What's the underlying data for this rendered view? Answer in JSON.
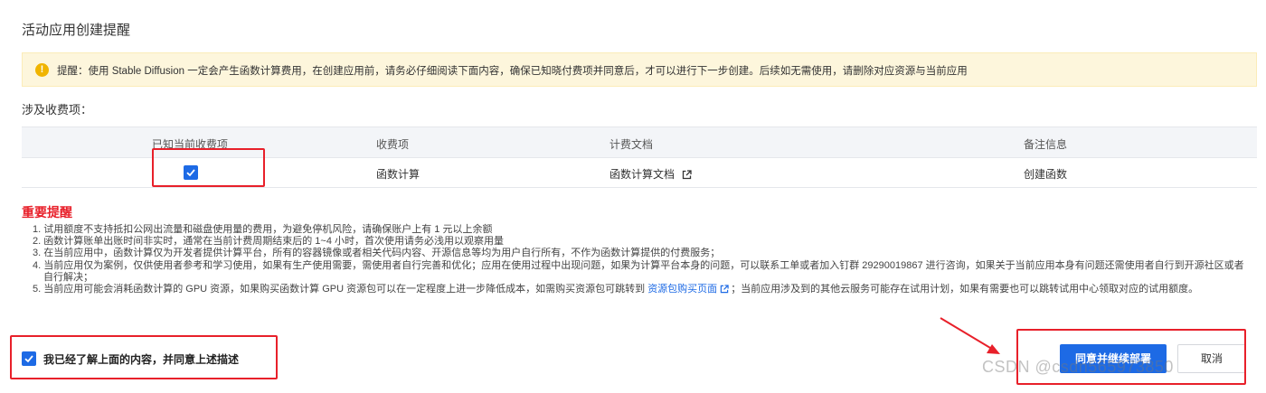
{
  "page": {
    "title": "活动应用创建提醒"
  },
  "notice": {
    "icon": "warning-icon",
    "text": "提醒：使用 Stable Diffusion 一定会产生函数计算费用，在创建应用前，请务必仔细阅读下面内容，确保已知晓付费项并同意后，才可以进行下一步创建。后续如无需使用，请删除对应资源与当前应用"
  },
  "billing": {
    "section_label": "涉及收费项：",
    "headers": [
      "已知当前收费项",
      "收费项",
      "计费文档",
      "备注信息"
    ],
    "rows": [
      {
        "acknowledged": true,
        "item": "函数计算",
        "doc_link": "函数计算文档",
        "remark": "创建函数"
      }
    ]
  },
  "important": {
    "title": "重要提醒",
    "notes": [
      "1. 试用额度不支持抵扣公网出流量和磁盘使用量的费用，为避免停机风险，请确保账户上有 1 元以上余额",
      "2. 函数计算账单出账时间非实时，通常在当前计费周期结束后的 1~4 小时，首次使用请务必浅用以观察用量",
      "3. 在当前应用中，函数计算仅为开发者提供计算平台，所有的容器镜像或者相关代码内容、开源信息等均为用户自行所有，不作为函数计算提供的付费服务；",
      "4. 当前应用仅为案例，仅供使用者参考和学习使用，如果有生产使用需要，需使用者自行完善和优化；应用在使用过程中出现问题，如果为计算平台本身的问题，可以联系工单或者加入钉群 29290019867 进行咨询，如果关于当前应用本身有问题还需使用者自行到开源社区或者自行解决；"
    ],
    "note5_pre": "5. 当前应用可能会消耗函数计算的 GPU 资源，如果购买函数计算 GPU 资源包可以在一定程度上进一步降低成本，如需购买资源包可跳转到 ",
    "note5_link": "资源包购买页面",
    "note5_post": "；当前应用涉及到的其他云服务可能存在试用计划，如果有需要也可以跳转试用中心领取对应的试用额度。"
  },
  "footer": {
    "agree_checked": true,
    "agree_label": "我已经了解上面的内容，并同意上述描述",
    "confirm_button": "同意并继续部署",
    "cancel_button": "取消"
  },
  "watermark": "CSDN @csdn565973850",
  "colors": {
    "primary": "#1d6ae5",
    "annotation_red": "#e8202a",
    "notice_bg": "#fdf6dc",
    "warning": "#f0b400"
  }
}
